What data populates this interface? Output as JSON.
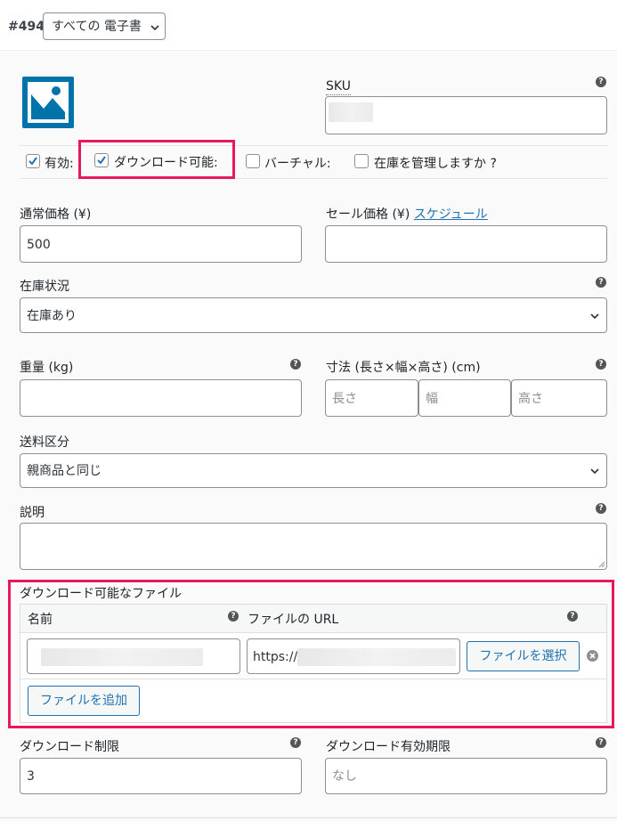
{
  "variation": {
    "id_label": "#494",
    "select_value": "すべての 電子書",
    "image_icon": "placeholder-image-icon"
  },
  "sku": {
    "label": "SKU",
    "value": ""
  },
  "options": {
    "enabled_label": "有効:",
    "downloadable_label": "ダウンロード可能:",
    "virtual_label": "バーチャル:",
    "manage_stock_label": "在庫を管理しますか ?"
  },
  "pricing": {
    "regular_label": "通常価格 (¥)",
    "regular_value": "500",
    "sale_label": "セール価格 (¥)",
    "schedule_link": "スケジュール",
    "sale_value": ""
  },
  "stock": {
    "label": "在庫状況",
    "value": "在庫あり"
  },
  "weight": {
    "label": "重量 (kg)",
    "value": ""
  },
  "dimensions": {
    "label": "寸法 (長さ×幅×高さ) (cm)",
    "length_placeholder": "長さ",
    "width_placeholder": "幅",
    "height_placeholder": "高さ"
  },
  "shipping": {
    "label": "送料区分",
    "value": "親商品と同じ"
  },
  "description": {
    "label": "説明",
    "value": ""
  },
  "downloads": {
    "section_label": "ダウンロード可能なファイル",
    "name_header": "名前",
    "url_header": "ファイルの URL",
    "url_value": "https://",
    "choose_file_button": "ファイルを選択",
    "add_file_button": "ファイルを追加"
  },
  "download_limit": {
    "label": "ダウンロード制限",
    "value": "3"
  },
  "download_expiry": {
    "label": "ダウンロード有効期限",
    "value": "なし"
  },
  "colors": {
    "highlight": "#e6195e",
    "link": "#2271b1",
    "image_icon": "#0073aa"
  }
}
